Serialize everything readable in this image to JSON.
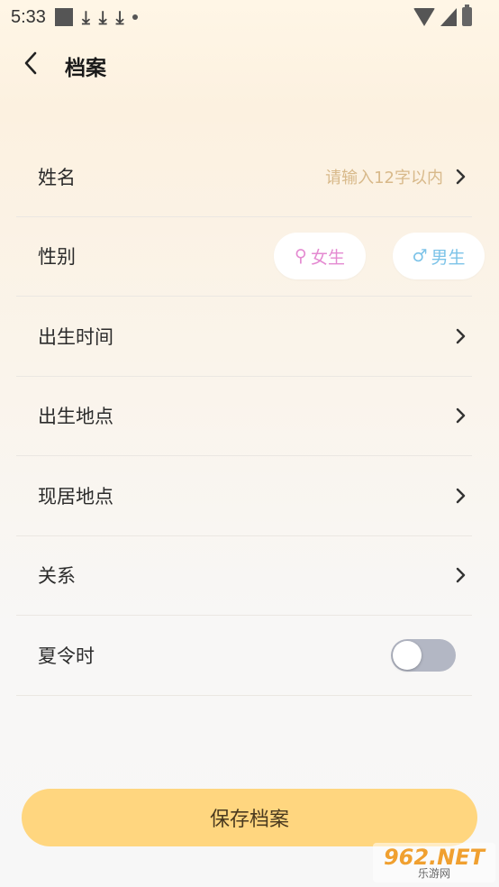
{
  "status_bar": {
    "time": "5:33"
  },
  "header": {
    "title": "档案"
  },
  "form": {
    "name": {
      "label": "姓名",
      "placeholder": "请输入12字以内"
    },
    "gender": {
      "label": "性别",
      "female": {
        "symbol": "⚲",
        "label": "女生",
        "color": "#e48ad1"
      },
      "male": {
        "symbol": "♂",
        "label": "男生",
        "color": "#7cc3e8"
      }
    },
    "birth_time": {
      "label": "出生时间"
    },
    "birth_place": {
      "label": "出生地点"
    },
    "current_place": {
      "label": "现居地点"
    },
    "relation": {
      "label": "关系"
    },
    "dst": {
      "label": "夏令时",
      "enabled": false
    }
  },
  "save_button": {
    "label": "保存档案",
    "color": "#ffd67f"
  },
  "watermark": {
    "main": "962.NET",
    "sub": "乐游网"
  }
}
